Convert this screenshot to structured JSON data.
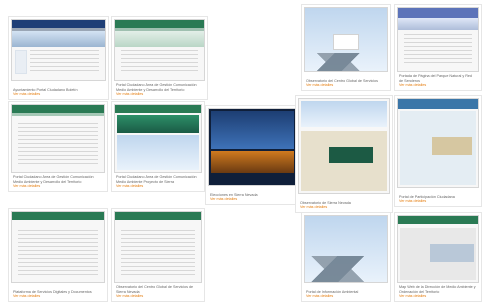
{
  "gallery": {
    "items": [
      {
        "caption": "Ayuntamiento Portal Ciudadano Boletín",
        "link": "Ver más detalles"
      },
      {
        "caption": "Portal Ciudadano Área de Gestión Comunicación Medio Ambiente y Desarrollo del Territorio",
        "link": "Ver más detalles"
      },
      {
        "caption": "Observatorio del Centro Global de Servicios",
        "link": "Ver más detalles"
      },
      {
        "caption": "Portada de Página del Parque Natural y Red de Senderos",
        "link": "Ver más detalles"
      },
      {
        "caption": "Portal Ciudadano Área de Gestión Comunicación Medio Ambiente y Desarrollo del Territorio",
        "link": "Ver más detalles"
      },
      {
        "caption": "Portal Ciudadano Área de Gestión Comunicación Medio Ambiente Proyecto de Sierra",
        "link": "Ver más detalles"
      },
      {
        "caption": "Elecciones en Sierra Nevada",
        "link": "Ver más detalles"
      },
      {
        "caption": "Observatorio de Sierra Nevada",
        "link": "Ver más detalles"
      },
      {
        "caption": "Portal de Participación Ciudadana",
        "link": "Ver más detalles"
      },
      {
        "caption": "Plataforma de Servicios Digitales y Documentos",
        "link": "Ver más detalles"
      },
      {
        "caption": "Observatorio del Centro Global de Servicios de Sierra Nevada",
        "link": "Ver más detalles"
      },
      {
        "caption": "Portal de Información Ambiental",
        "link": "Ver más detalles"
      },
      {
        "caption": "Map Web de la Dirección de Medio Ambiente y Ordenación del Territorio",
        "link": "Ver más detalles"
      }
    ]
  }
}
